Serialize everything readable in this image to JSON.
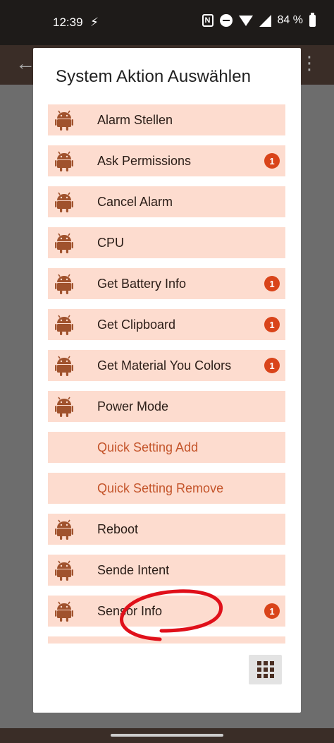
{
  "status_bar": {
    "time": "12:39",
    "charge_glyph": "⚡",
    "nfc_glyph": "N",
    "battery_percent": "84 %"
  },
  "dialog": {
    "title": "System Aktion Auswählen",
    "items": [
      {
        "label": "Alarm Stellen",
        "icon": "android-icon",
        "badge": ""
      },
      {
        "label": "Ask Permissions",
        "icon": "android-icon",
        "badge": "1"
      },
      {
        "label": "Cancel Alarm",
        "icon": "android-icon",
        "badge": ""
      },
      {
        "label": "CPU",
        "icon": "android-icon",
        "badge": ""
      },
      {
        "label": "Get Battery Info",
        "icon": "android-icon",
        "badge": "1"
      },
      {
        "label": "Get Clipboard",
        "icon": "android-icon",
        "badge": "1"
      },
      {
        "label": "Get Material You Colors",
        "icon": "android-icon",
        "badge": "1"
      },
      {
        "label": "Power Mode",
        "icon": "android-icon",
        "badge": ""
      },
      {
        "label": "Quick Setting Add",
        "icon": "",
        "badge": ""
      },
      {
        "label": "Quick Setting Remove",
        "icon": "",
        "badge": ""
      },
      {
        "label": "Reboot",
        "icon": "android-icon",
        "badge": ""
      },
      {
        "label": "Sende Intent",
        "icon": "android-icon",
        "badge": ""
      },
      {
        "label": "Sensor Info",
        "icon": "android-icon",
        "badge": "1"
      }
    ],
    "grid_button_icon": "grid-icon"
  },
  "colors": {
    "item_background": "#fddccf",
    "badge": "#d9441a",
    "android_icon": "#a0522d",
    "link_text": "#c4542a",
    "annotation": "#e0101a"
  }
}
